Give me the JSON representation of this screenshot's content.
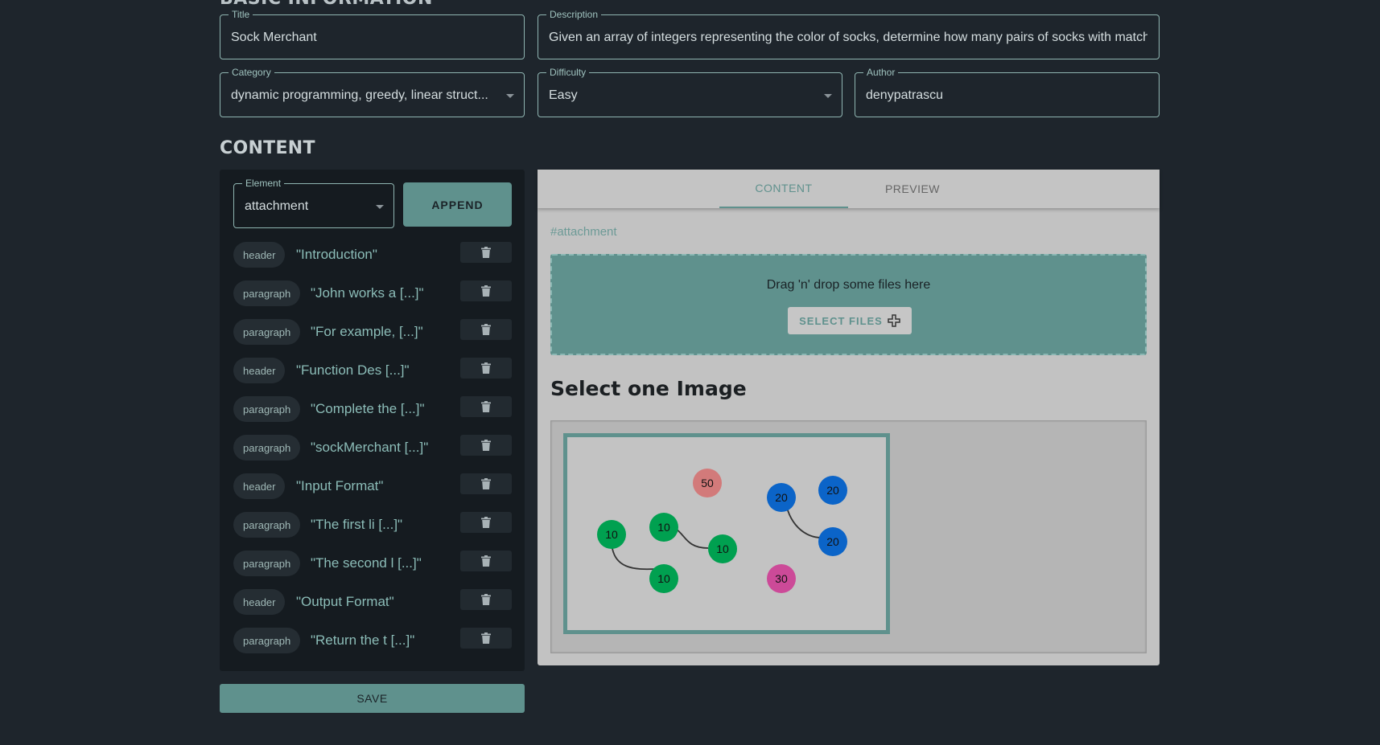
{
  "basic_info": {
    "section_title": "BASIC INFORMATION",
    "title": {
      "label": "Title",
      "value": "Sock Merchant"
    },
    "description": {
      "label": "Description",
      "value": "Given an array of integers representing the color of socks, determine how many pairs of socks with matching colors there are."
    },
    "category": {
      "label": "Category",
      "value": "dynamic programming, greedy, linear struct..."
    },
    "difficulty": {
      "label": "Difficulty",
      "value": "Easy"
    },
    "author": {
      "label": "Author",
      "value": "denypatrascu"
    }
  },
  "content": {
    "section_title": "CONTENT",
    "element_select": {
      "label": "Element",
      "value": "attachment"
    },
    "append_label": "APPEND",
    "items": [
      {
        "type": "header",
        "text": "\"Introduction\""
      },
      {
        "type": "paragraph",
        "text": "\"John works a [...]\""
      },
      {
        "type": "paragraph",
        "text": "\"For example, [...]\""
      },
      {
        "type": "header",
        "text": "\"Function Des [...]\""
      },
      {
        "type": "paragraph",
        "text": "\"Complete the [...]\""
      },
      {
        "type": "paragraph",
        "text": "\"sockMerchant [...]\""
      },
      {
        "type": "header",
        "text": "\"Input Format\""
      },
      {
        "type": "paragraph",
        "text": "\"The first li [...]\""
      },
      {
        "type": "paragraph",
        "text": "\"The second l [...]\""
      },
      {
        "type": "header",
        "text": "\"Output Format\""
      },
      {
        "type": "paragraph",
        "text": "\"Return the t [...]\""
      }
    ],
    "save_label": "SAVE"
  },
  "editor": {
    "tabs": [
      {
        "label": "CONTENT",
        "active": true
      },
      {
        "label": "PREVIEW",
        "active": false
      }
    ],
    "element_tag": "#attachment",
    "dropzone_text": "Drag 'n' drop some files here",
    "select_files_label": "SELECT FILES",
    "select_image_title": "Select one Image",
    "thumbnail_nodes": [
      "50",
      "20",
      "20",
      "10",
      "10",
      "10",
      "20",
      "10",
      "30"
    ]
  },
  "colors": {
    "accent": "#5f918d",
    "background": "#1e252c",
    "panel": "#151b20",
    "node_green": "#00a050",
    "node_blue": "#0b64c8",
    "node_salmon": "#d27a7a",
    "node_pink": "#cc4a98"
  }
}
